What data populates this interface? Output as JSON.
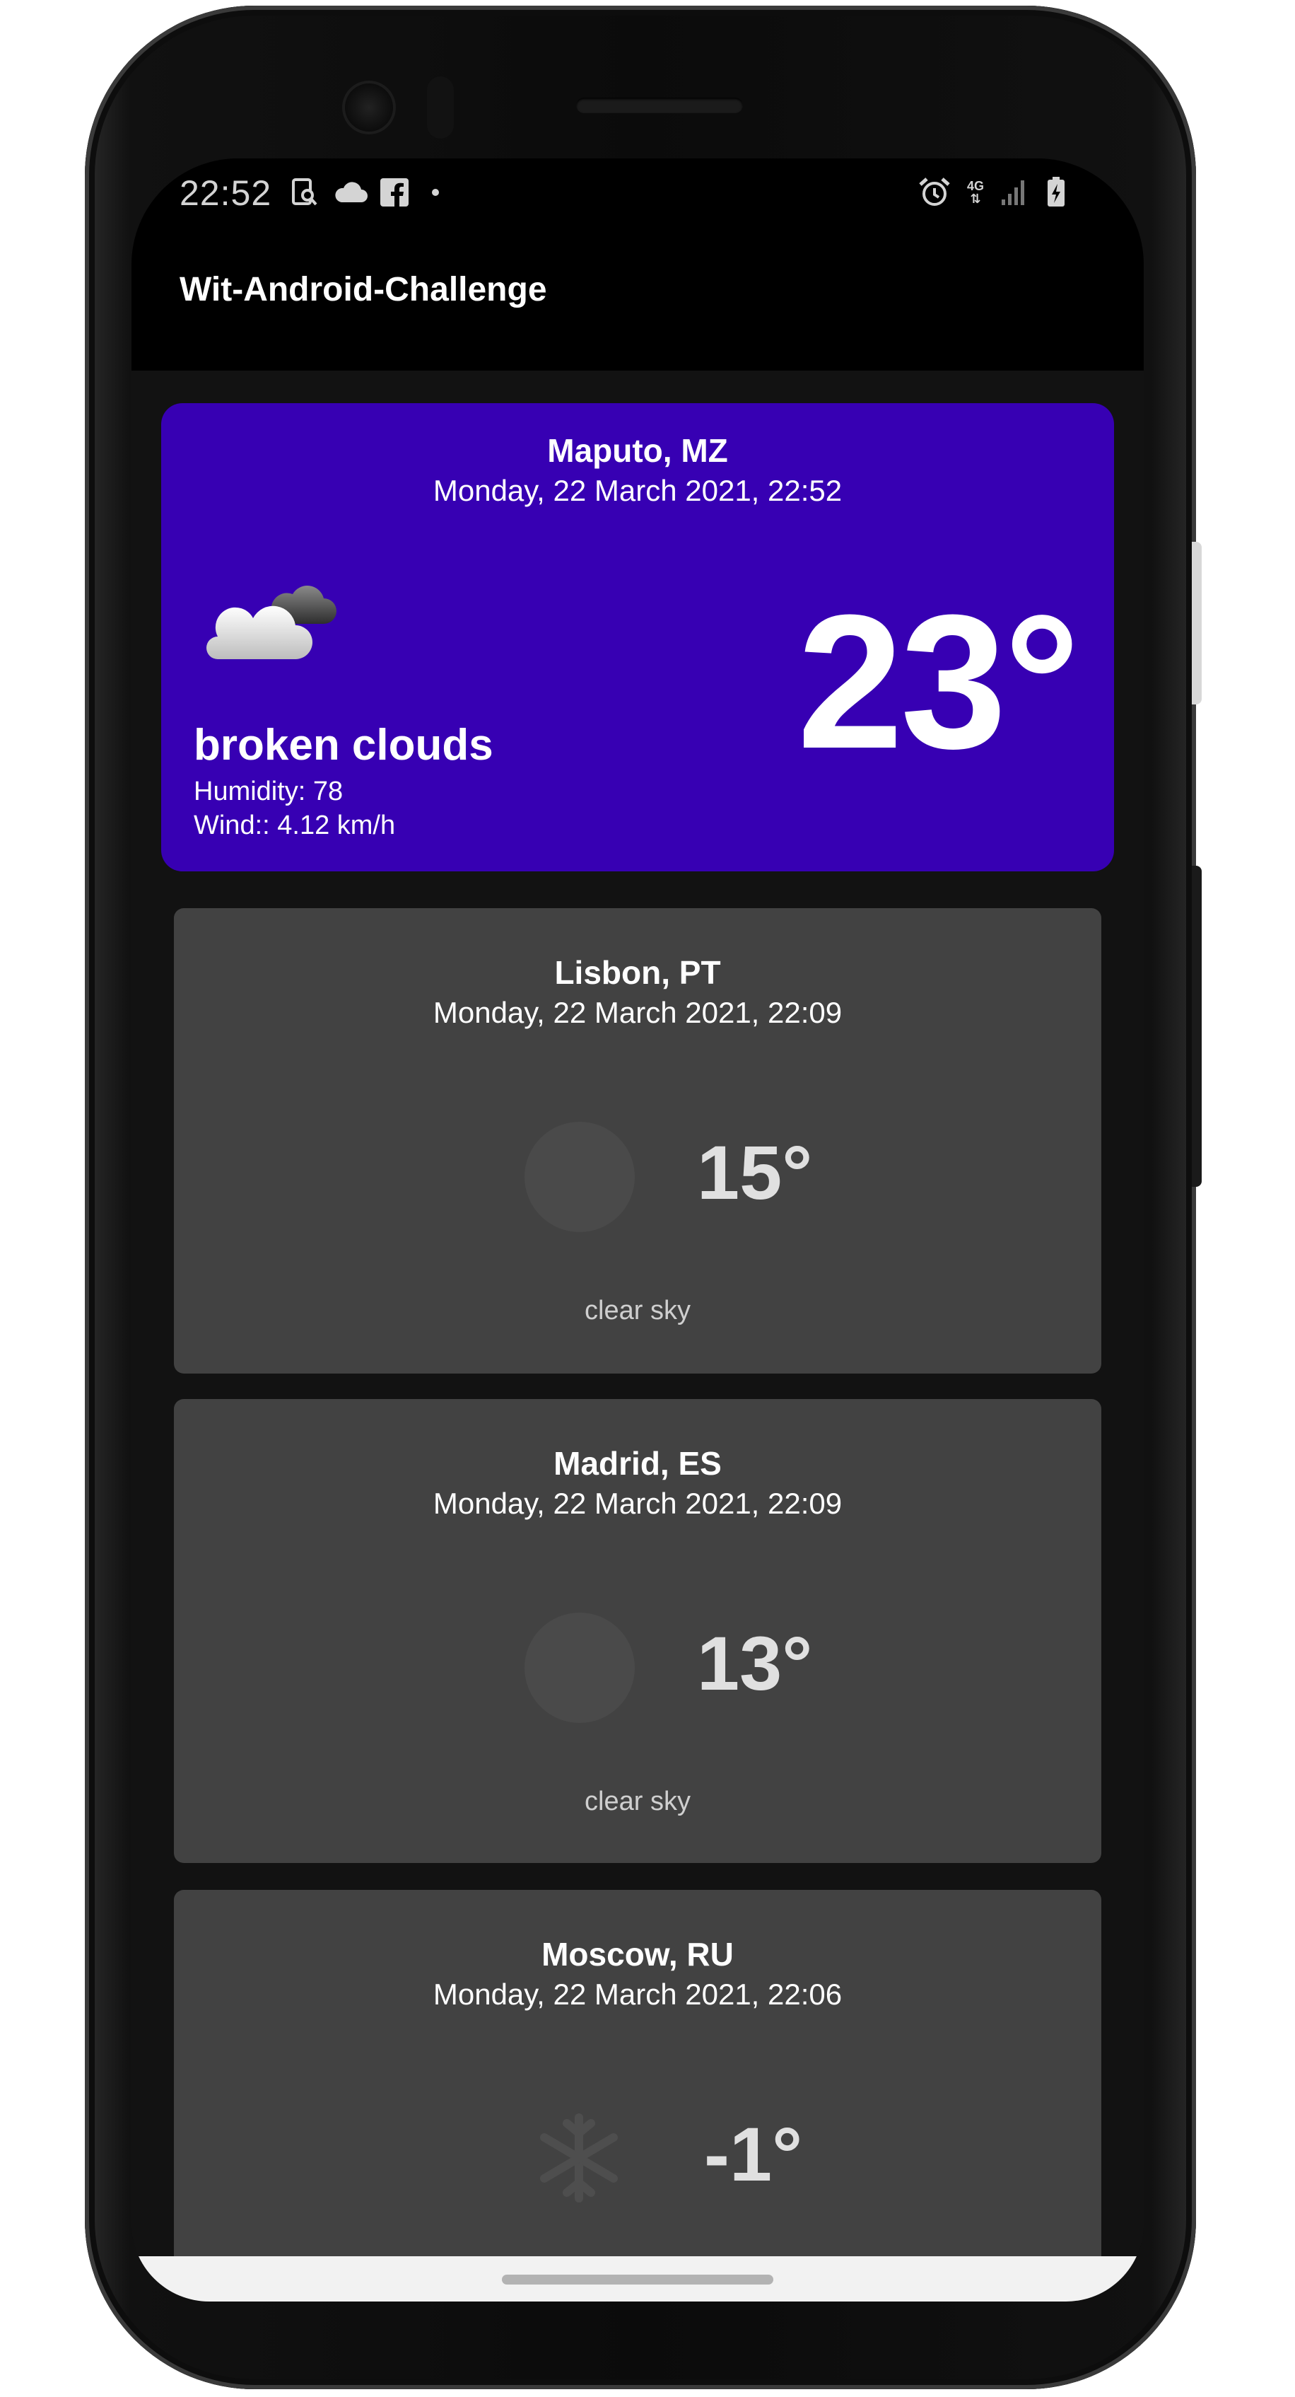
{
  "status_bar": {
    "time": "22:52",
    "left_icons": [
      "screen-search-icon",
      "cloud-icon",
      "facebook-icon",
      "dot-icon"
    ],
    "right_icons": [
      "alarm-icon",
      "4g-signal-icon",
      "signal-bars-icon",
      "battery-charging-icon"
    ],
    "network_label": "4G"
  },
  "app_bar": {
    "title": "Wit-Android-Challenge"
  },
  "featured": {
    "city": "Maputo, MZ",
    "datetime": "Monday, 22 March 2021, 22:52",
    "temperature": "23°",
    "description": "broken clouds",
    "humidity": "Humidity: 78",
    "wind": "Wind:: 4.12 km/h",
    "icon": "broken-clouds-icon",
    "background_color": "#3700b3"
  },
  "cities": [
    {
      "city": "Lisbon, PT",
      "datetime": "Monday, 22 March 2021, 22:09",
      "temperature": "15°",
      "description": "clear sky",
      "icon": "clear-sky-icon"
    },
    {
      "city": "Madrid, ES",
      "datetime": "Monday, 22 March 2021, 22:09",
      "temperature": "13°",
      "description": "clear sky",
      "icon": "clear-sky-icon"
    },
    {
      "city": "Moscow, RU",
      "datetime": "Monday, 22 March 2021, 22:06",
      "temperature": "-1°",
      "description": "",
      "icon": "snow-icon"
    }
  ],
  "colors": {
    "card_background": "#424242",
    "screen_background": "#121212",
    "app_bar_background": "#000000"
  }
}
